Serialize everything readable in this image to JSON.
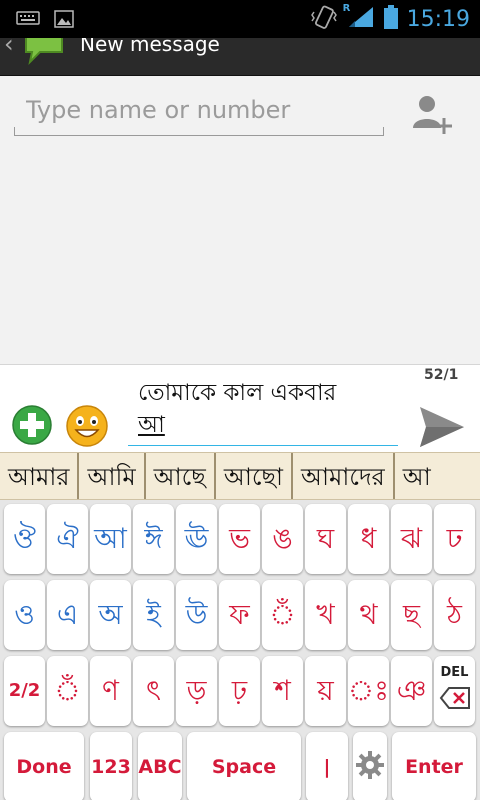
{
  "statusbar": {
    "time": "15:19",
    "icons": [
      "keyboard-icon",
      "image-icon",
      "vibrate-icon",
      "roaming-signal-icon",
      "battery-icon"
    ],
    "roaming_mark": "R"
  },
  "actionbar": {
    "title": "New message",
    "icon": "messaging-app-icon"
  },
  "recipient": {
    "placeholder": "Type name or number",
    "add_contact_icon": "add-contact-icon"
  },
  "compose": {
    "counter": "52/1",
    "message_line1": "তোমাকে কাল একবার",
    "message_composing": "আ",
    "attach_icon": "plus-circle-icon",
    "emoji_icon": "smiley-icon",
    "send_icon": "send-icon"
  },
  "suggestions": [
    "আমার",
    "আমি",
    "আছে",
    "আছো",
    "আমাদের",
    "আ"
  ],
  "keyboard": {
    "row1": [
      {
        "g": "ঔ",
        "c": "blue"
      },
      {
        "g": "ঐ",
        "c": "blue"
      },
      {
        "g": "আ",
        "c": "blue"
      },
      {
        "g": "ঈ",
        "c": "blue"
      },
      {
        "g": "ঊ",
        "c": "blue"
      },
      {
        "g": "ভ",
        "c": "red"
      },
      {
        "g": "ঙ",
        "c": "red"
      },
      {
        "g": "ঘ",
        "c": "red"
      },
      {
        "g": "ধ",
        "c": "red"
      },
      {
        "g": "ঝ",
        "c": "red"
      },
      {
        "g": "ঢ",
        "c": "red"
      }
    ],
    "row2": [
      {
        "g": "ও",
        "c": "blue"
      },
      {
        "g": "এ",
        "c": "blue"
      },
      {
        "g": "অ",
        "c": "blue"
      },
      {
        "g": "ই",
        "c": "blue"
      },
      {
        "g": "উ",
        "c": "blue"
      },
      {
        "g": "ফ",
        "c": "red"
      },
      {
        "g": "◌ঁ",
        "c": "red"
      },
      {
        "g": "খ",
        "c": "red"
      },
      {
        "g": "থ",
        "c": "red"
      },
      {
        "g": "ছ",
        "c": "red"
      },
      {
        "g": "ঠ",
        "c": "red"
      }
    ],
    "row3": [
      {
        "g": "2/2",
        "c": "red"
      },
      {
        "g": "◌ঁ",
        "c": "red"
      },
      {
        "g": "ণ",
        "c": "red"
      },
      {
        "g": "ৎ",
        "c": "red"
      },
      {
        "g": "ড়",
        "c": "red"
      },
      {
        "g": "ঢ়",
        "c": "red"
      },
      {
        "g": "শ",
        "c": "red"
      },
      {
        "g": "য়",
        "c": "red"
      },
      {
        "g": "◌ঃ",
        "c": "red"
      },
      {
        "g": "ঞ",
        "c": "red"
      },
      {
        "g": "DEL",
        "c": "red"
      }
    ],
    "row4": {
      "done": "Done",
      "num": "123",
      "abc": "ABC",
      "space": "Space",
      "pipe": "|",
      "settings_icon": "gear-icon",
      "enter": "Enter"
    }
  },
  "colors": {
    "accent": "#33b5e5",
    "key_blue": "#2b6fc8",
    "key_red": "#d41a3a",
    "suggest_bg": "#f4ecd8"
  }
}
